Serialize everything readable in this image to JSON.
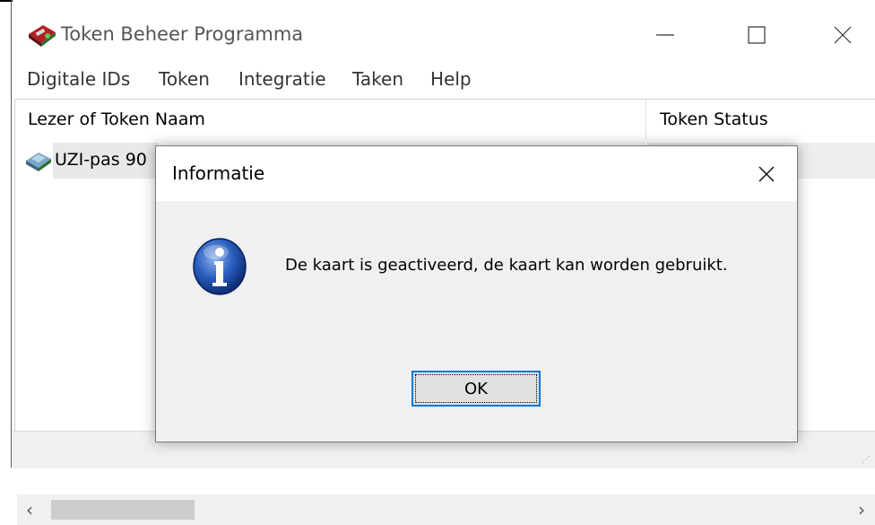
{
  "window": {
    "title": "Token Beheer Programma"
  },
  "menu": {
    "items": [
      "Digitale IDs",
      "Token",
      "Integratie",
      "Taken",
      "Help"
    ]
  },
  "list": {
    "columns": [
      "Lezer of Token Naam",
      "Token Status"
    ],
    "rows": [
      {
        "name": "UZI-pas 90",
        "status": ""
      }
    ]
  },
  "dialog": {
    "title": "Informatie",
    "message": "De kaart is geactiveerd, de kaart kan worden gebruikt.",
    "ok_label": "OK",
    "icon": "info-icon"
  },
  "colors": {
    "accent": "#0078d7",
    "dialog_bg": "#f0f0f0",
    "selection": "#e8e8e8"
  }
}
